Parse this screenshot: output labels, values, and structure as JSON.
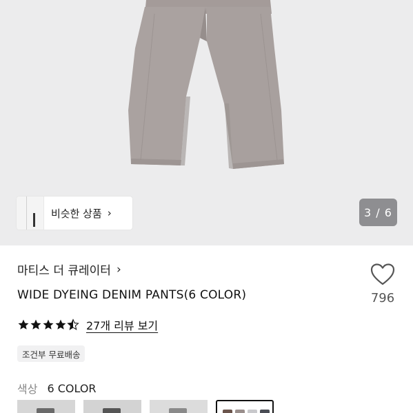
{
  "gallery": {
    "similar_label": "비슷한 상품",
    "chevron": "›",
    "counter": "3 / 6"
  },
  "product": {
    "brand": "마티스 더 큐레이터",
    "brand_chevron": "›",
    "title": "WIDE DYEING DENIM PANTS(6 COLOR)",
    "like_count": "796",
    "rating": 4.5,
    "review_link": "27개 리뷰 보기",
    "shipping_badge": "조건부 무료배송",
    "color_label": "색상",
    "color_value": "6 COLOR"
  },
  "icons": {
    "heart": "heart-icon",
    "star": "star-icon",
    "chevron": "chevron-right-icon"
  },
  "colors": {
    "pants": "#a8a09e",
    "hero_bg": "#ececed",
    "counter_bg": "#8e8e91",
    "star": "#111111"
  }
}
